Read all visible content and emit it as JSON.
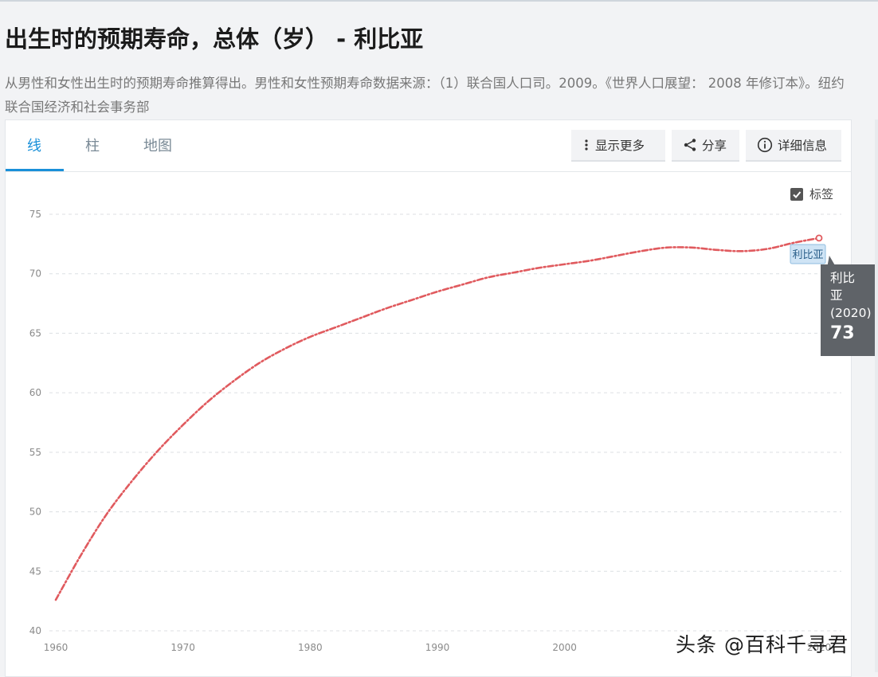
{
  "page": {
    "title": "出生时的预期寿命，总体（岁） - 利比亚",
    "subtitle": "从男性和女性出生时的预期寿命推算得出。男性和女性预期寿命数据来源：（1）联合国人口司。2009。《世界人口展望： 2008 年修订本》。纽约联合国经济和社会事务部"
  },
  "tabs": [
    {
      "label": "线",
      "active": true
    },
    {
      "label": "柱",
      "active": false
    },
    {
      "label": "地图",
      "active": false
    }
  ],
  "toolbar": {
    "more_label": "显示更多",
    "share_label": "分享",
    "details_label": "详细信息"
  },
  "labels_toggle": {
    "label": "标签",
    "checked": true
  },
  "tooltip": {
    "series": "利比亚",
    "year_line": "(2020)",
    "value": "73",
    "series_line1": "利比",
    "series_line2": "亚"
  },
  "series_label": "利比亚",
  "watermark": "头条 @百科千寻君",
  "colors": {
    "line": "#e05a5e",
    "accent": "#1a90d9",
    "tooltip_bg": "#5f6368"
  },
  "chart_data": {
    "type": "line",
    "title": "",
    "xlabel": "",
    "ylabel": "",
    "x_ticks": [
      "1960",
      "1970",
      "1980",
      "1990",
      "2000",
      "2020"
    ],
    "y_ticks": [
      "40",
      "45",
      "50",
      "55",
      "60",
      "65",
      "70",
      "75"
    ],
    "xlim": [
      1960,
      2020
    ],
    "ylim": [
      40,
      75
    ],
    "grid": true,
    "series": [
      {
        "name": "利比亚",
        "x": [
          1960,
          1962,
          1964,
          1966,
          1968,
          1970,
          1972,
          1974,
          1976,
          1978,
          1980,
          1982,
          1984,
          1986,
          1988,
          1990,
          1992,
          1994,
          1996,
          1998,
          2000,
          2002,
          2004,
          2006,
          2008,
          2010,
          2012,
          2014,
          2016,
          2018,
          2020
        ],
        "values": [
          42.6,
          46.4,
          49.8,
          52.6,
          55.1,
          57.3,
          59.3,
          61.0,
          62.5,
          63.7,
          64.7,
          65.5,
          66.3,
          67.1,
          67.8,
          68.5,
          69.1,
          69.7,
          70.1,
          70.5,
          70.8,
          71.1,
          71.5,
          71.9,
          72.2,
          72.2,
          72.0,
          71.9,
          72.1,
          72.6,
          73.0
        ]
      }
    ]
  }
}
